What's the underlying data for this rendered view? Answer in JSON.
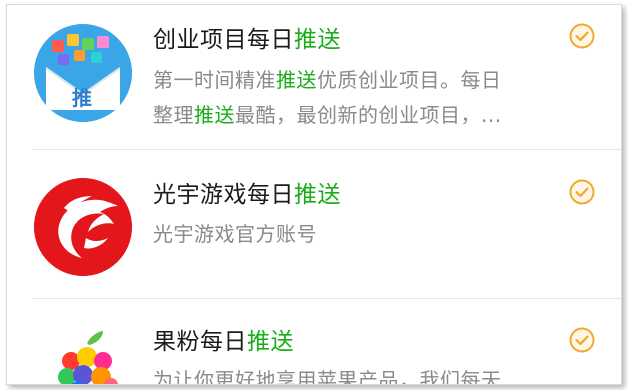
{
  "highlight_color": "#1aad19",
  "check_color": "#f2a931",
  "items": [
    {
      "title_prefix": "创业项目每日",
      "title_highlight": "推送",
      "avatar_badge": "推",
      "icon": "envelope-app-icons-avatar",
      "desc_lines": [
        [
          "第一时间精准",
          "推送",
          "优质创业项目。每日"
        ],
        [
          "整理",
          "推送",
          "最酷，最创新的创业项目，..."
        ]
      ],
      "checked": true
    },
    {
      "title_prefix": "光宇游戏每日",
      "title_highlight": "推送",
      "icon": "phoenix-logo-avatar",
      "desc": "光宇游戏官方账号",
      "checked": true
    },
    {
      "title_prefix": "果粉每日",
      "title_highlight": "推送",
      "icon": "colorful-apple-avatar",
      "desc": "为让你更好地享用苹果产品，我们每天",
      "checked": true
    }
  ]
}
